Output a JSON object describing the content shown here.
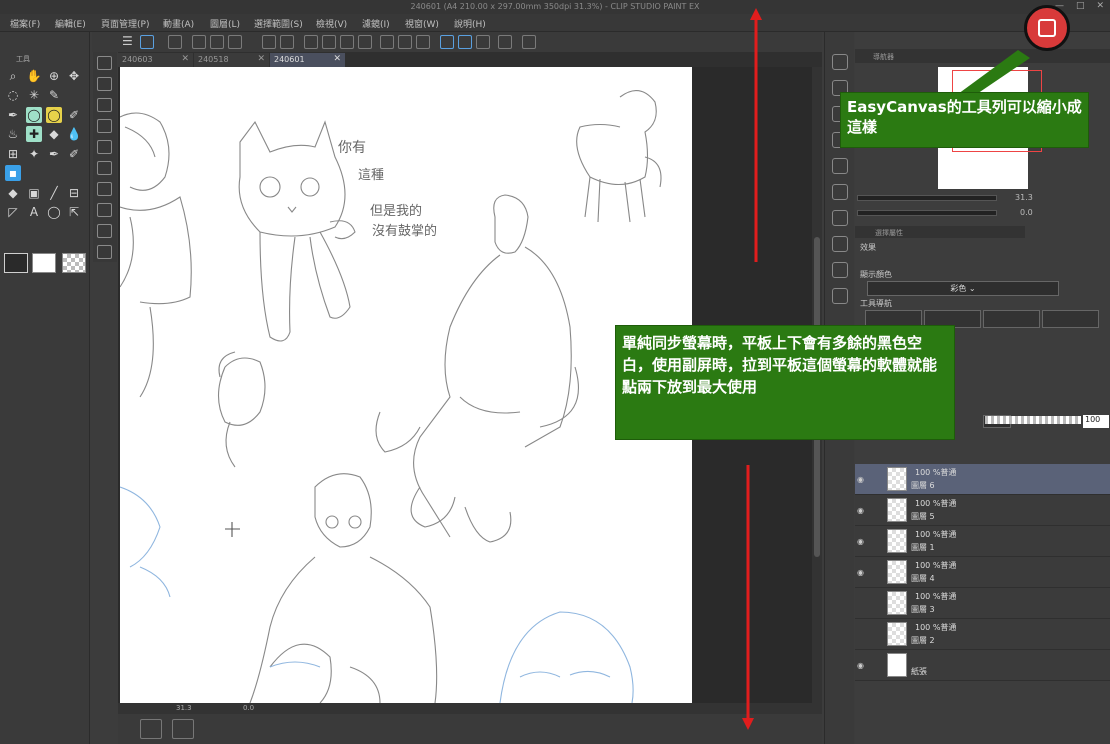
{
  "window": {
    "title": "240601 (A4 210.00 x 297.00mm 350dpi 31.3%)  - CLIP STUDIO PAINT EX",
    "controls": [
      "—",
      "□",
      "✕"
    ]
  },
  "menu": [
    "檔案(F)",
    "編輯(E)",
    "頁面管理(P)",
    "動畫(A)",
    "圖層(L)",
    "選擇範圍(S)",
    "檢視(V)",
    "濾鏡(I)",
    "視窗(W)",
    "說明(H)"
  ],
  "tool_panel": {
    "tab_label": "工具"
  },
  "document_tabs": [
    {
      "label": "240603",
      "active": false
    },
    {
      "label": "240518",
      "active": false
    },
    {
      "label": "240601",
      "active": true
    }
  ],
  "status": {
    "zoom": "31.3",
    "rotation": "0.0"
  },
  "navigator": {
    "tab_label": "導航器",
    "zoom_value": "31.3",
    "rotation_value": "0.0"
  },
  "tool_property": {
    "tab_label": "選擇屬性",
    "effect_label": "效果",
    "display_color_label": "顯示顏色",
    "color_value": "彩色",
    "tool_nav_label": "工具導航"
  },
  "layers": {
    "opacity": "100",
    "items": [
      {
        "mode": "100 %普通",
        "name": "圖層 6",
        "selected": true,
        "visible": true,
        "thumb": "checker"
      },
      {
        "mode": "100 %普通",
        "name": "圖層 5",
        "selected": false,
        "visible": true,
        "thumb": "checker"
      },
      {
        "mode": "100 %普通",
        "name": "圖層 1",
        "selected": false,
        "visible": true,
        "thumb": "checker"
      },
      {
        "mode": "100 %普通",
        "name": "圖層 4",
        "selected": false,
        "visible": true,
        "thumb": "checker"
      },
      {
        "mode": "100 %普通",
        "name": "圖層 3",
        "selected": false,
        "visible": false,
        "thumb": "checker"
      },
      {
        "mode": "100 %普通",
        "name": "圖層 2",
        "selected": false,
        "visible": false,
        "thumb": "checker"
      },
      {
        "mode": "",
        "name": "紙張",
        "selected": false,
        "visible": true,
        "thumb": "white"
      }
    ]
  },
  "canvas_notes": {
    "note1": "你有",
    "note2": "這種",
    "note3": "但是我的",
    "note4": "沒有鼓掌的"
  },
  "annotations": {
    "callout_top": "EasyCanvas的工具列可以縮小成這樣",
    "callout_middle": "單純同步螢幕時，平板上下會有多餘的黑色空白，使用副屏時，拉到平板這個螢幕的軟體就能點兩下放到最大使用"
  },
  "colors": {
    "callout_green": "#2b7a12",
    "arrow_red": "#e11d1d",
    "badge_red": "#d83a3a",
    "selection_blue": "#5a6278"
  }
}
